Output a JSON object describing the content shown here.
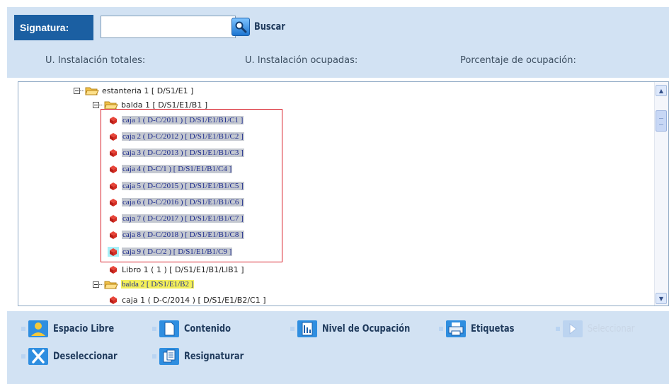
{
  "header": {
    "signatura_label": "Signatura:",
    "signatura_value": "",
    "search_label": "Buscar",
    "stats": {
      "total_label": "U. Instalación totales:",
      "occupied_label": "U. Instalación ocupadas:",
      "percent_label": "Porcentaje de ocupación:"
    }
  },
  "tree": {
    "estanteria": "estanteria 1 [ D/S1/E1 ]",
    "balda1": "balda 1 [ D/S1/E1/B1 ]",
    "cajas": [
      "caja 1 ( D-C/2011 ) [ D/S1/E1/B1/C1 ]",
      "caja 2 ( D-C/2012 ) [ D/S1/E1/B1/C2 ]",
      "caja 3 ( D-C/2013 ) [ D/S1/E1/B1/C3 ]",
      "caja 4 ( D-C/1 ) [ D/S1/E1/B1/C4 ]",
      "caja 5 ( D-C/2015 ) [ D/S1/E1/B1/C5 ]",
      "caja 6 ( D-C/2016 ) [ D/S1/E1/B1/C6 ]",
      "caja 7 ( D-C/2017 ) [ D/S1/E1/B1/C7 ]",
      "caja 8 ( D-C/2018 ) [ D/S1/E1/B1/C8 ]",
      "caja 9 ( D-C/2 ) [ D/S1/E1/B1/C9 ]"
    ],
    "libro": "Libro 1 ( 1 ) [ D/S1/E1/B1/LIB1 ]",
    "balda2": "balda 2 [ D/S1/E1/B2 ]",
    "balda2_caja": "caja 1 ( D-C/2014 ) [ D/S1/E1/B2/C1 ]"
  },
  "toolbar": {
    "espacio_libre": "Espacio Libre",
    "contenido": "Contenido",
    "nivel_ocupacion": "Nivel de Ocupación",
    "etiquetas": "Etiquetas",
    "seleccionar": "Seleccionar",
    "deseleccionar": "Deseleccionar",
    "resignaturar": "Resignaturar"
  },
  "colors": {
    "panel_bg": "#d2e2f3",
    "label_bg": "#1b5fa2",
    "selection_box": "#d8202a",
    "highlight": "#f4f05a"
  }
}
